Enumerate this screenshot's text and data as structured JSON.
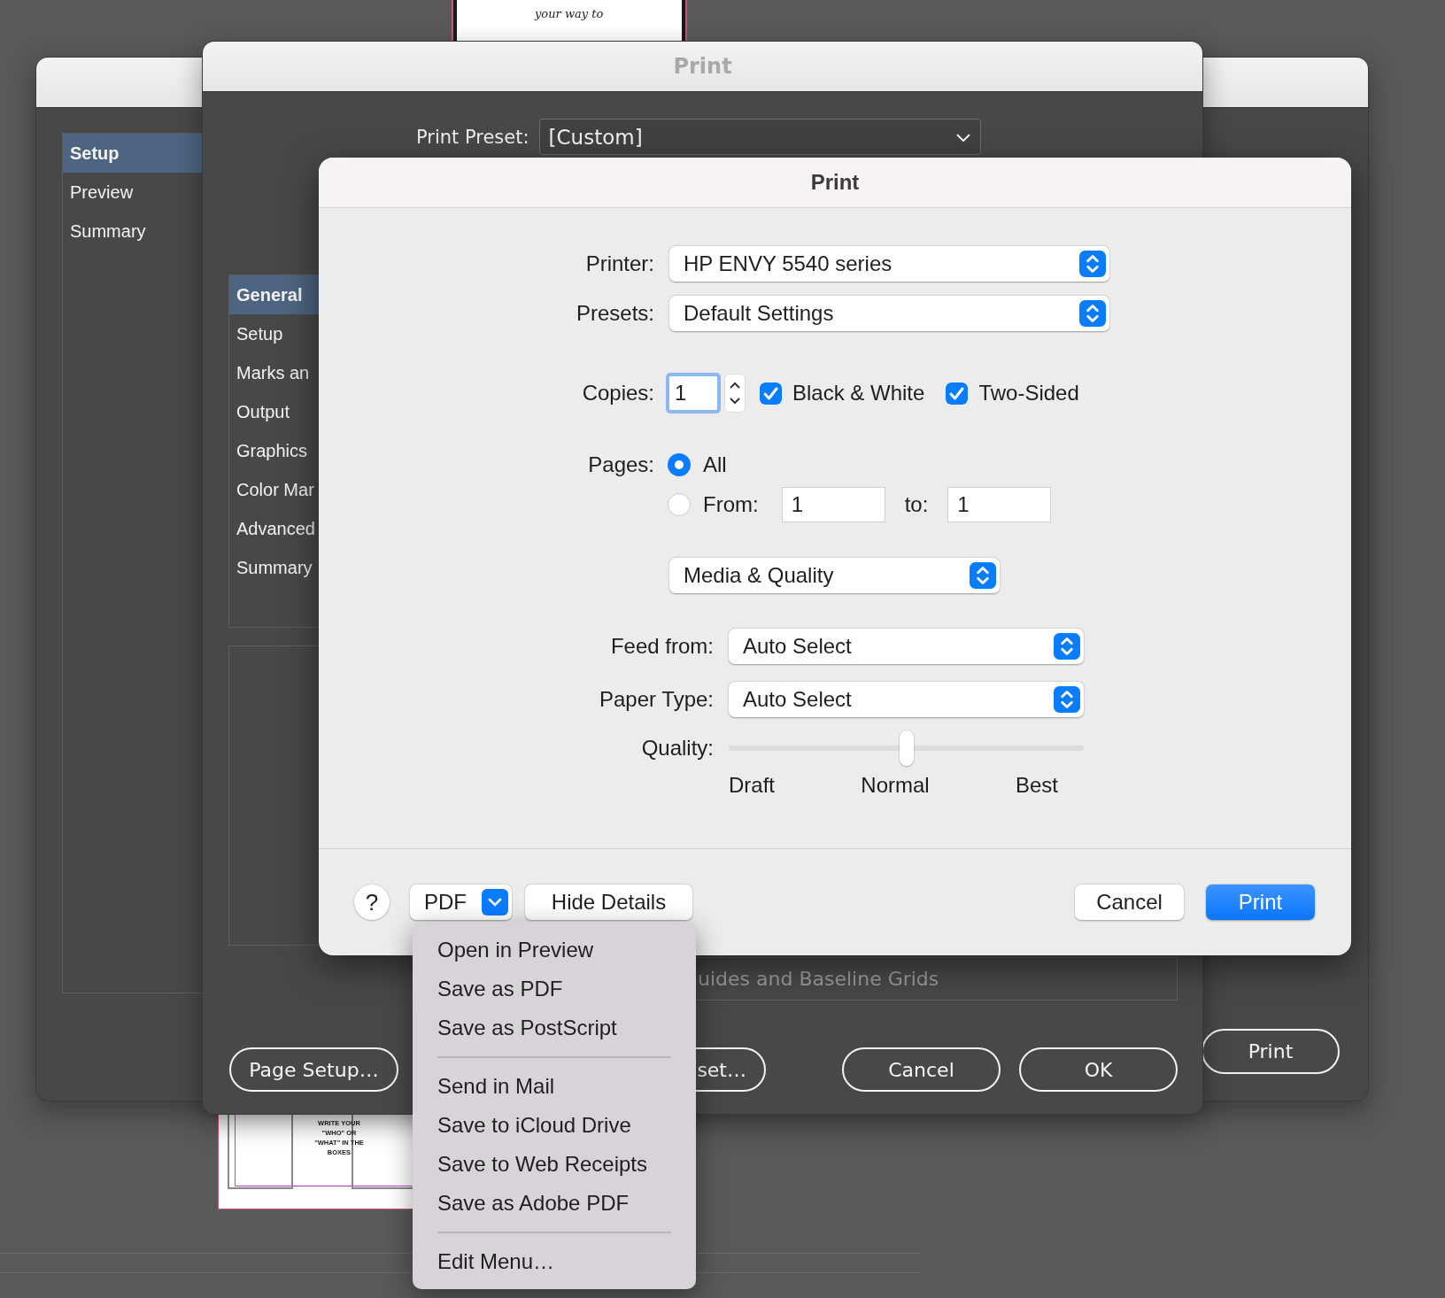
{
  "document_thumbnails": [
    {
      "kind": "top",
      "text": "your way to"
    },
    {
      "kind": "bottom",
      "text": "WRITE YOUR \"WHO\" OR \"WHAT\" IN THE BOXES"
    }
  ],
  "background_window": {
    "sidebar": {
      "items": [
        {
          "label": "Setup",
          "selected": true
        },
        {
          "label": "Preview",
          "selected": false
        },
        {
          "label": "Summary",
          "selected": false
        }
      ]
    },
    "print_button": "Print"
  },
  "indesign_print": {
    "title": "Print",
    "preset": {
      "label": "Print Preset:",
      "value": "[Custom]"
    },
    "sidebar": {
      "items": [
        {
          "label": "General",
          "selected": true
        },
        {
          "label": "Setup",
          "selected": false
        },
        {
          "label": "Marks an",
          "selected": false
        },
        {
          "label": "Output",
          "selected": false
        },
        {
          "label": "Graphics",
          "selected": false
        },
        {
          "label": "Color Mar",
          "selected": false
        },
        {
          "label": "Advanced",
          "selected": false
        },
        {
          "label": "Summary",
          "selected": false
        }
      ]
    },
    "panel_text": "uides and Baseline Grids",
    "buttons": [
      "Page Setup…",
      "set…",
      "Cancel",
      "OK"
    ]
  },
  "print_dialog": {
    "title": "Print",
    "printer": {
      "label": "Printer:",
      "value": "HP ENVY 5540 series"
    },
    "presets": {
      "label": "Presets:",
      "value": "Default Settings"
    },
    "copies": {
      "label": "Copies:",
      "value": "1"
    },
    "options": [
      {
        "label": "Black & White",
        "checked": true
      },
      {
        "label": "Two-Sided",
        "checked": true
      }
    ],
    "pages": {
      "label": "Pages:",
      "choices": [
        {
          "label": "All",
          "selected": true
        },
        {
          "label": "From:",
          "selected": false
        }
      ],
      "from": "1",
      "to_label": "to:",
      "to": "1"
    },
    "section": "Media & Quality",
    "feed_from": {
      "label": "Feed from:",
      "value": "Auto Select"
    },
    "paper_type": {
      "label": "Paper Type:",
      "value": "Auto Select"
    },
    "quality": {
      "label": "Quality:",
      "level": 0.5,
      "ticks": [
        "Draft",
        "Normal",
        "Best"
      ]
    },
    "help": "?",
    "pdf": "PDF",
    "hide_details": "Hide Details",
    "cancel": "Cancel",
    "print": "Print"
  },
  "pdf_menu": {
    "groups": [
      [
        "Open in Preview",
        "Save as PDF",
        "Save as PostScript"
      ],
      [
        "Send in Mail",
        "Save to iCloud Drive",
        "Save to Web Receipts",
        "Save as Adobe PDF"
      ],
      [
        "Edit Menu…"
      ]
    ]
  }
}
